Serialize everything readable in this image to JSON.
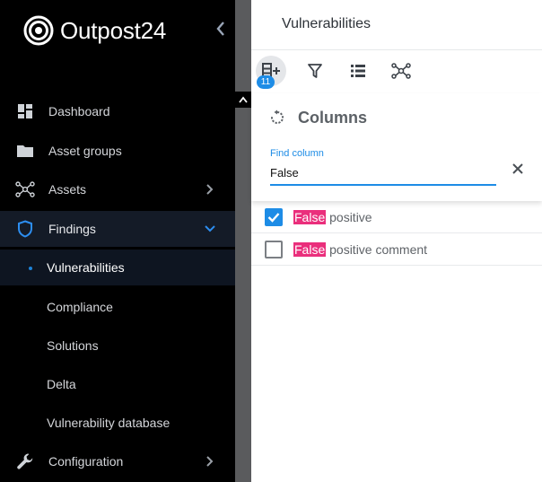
{
  "app": {
    "brand_main": "Outpost",
    "brand_num": "24"
  },
  "sidebar": {
    "items": [
      {
        "label": "Dashboard",
        "icon": "dashboard-icon"
      },
      {
        "label": "Asset groups",
        "icon": "folder-icon"
      },
      {
        "label": "Assets",
        "icon": "network-icon"
      },
      {
        "label": "Findings",
        "icon": "shield-icon",
        "expanded": true
      },
      {
        "label": "Configuration",
        "icon": "wrench-icon"
      }
    ],
    "findings_children": [
      {
        "label": "Vulnerabilities",
        "active": true
      },
      {
        "label": "Compliance"
      },
      {
        "label": "Solutions"
      },
      {
        "label": "Delta"
      },
      {
        "label": "Vulnerability database"
      }
    ]
  },
  "panel": {
    "title": "Vulnerabilities",
    "toolbar": {
      "columns_badge": "11",
      "buttons": [
        "columns-icon",
        "filter-icon",
        "list-icon",
        "graph-icon"
      ]
    },
    "columns": {
      "title": "Columns",
      "search_label": "Find column",
      "search_value": "False",
      "results": [
        {
          "match": "False",
          "rest": " positive",
          "checked": true
        },
        {
          "match": "False",
          "rest": " positive comment",
          "checked": false
        }
      ]
    }
  },
  "colors": {
    "accent": "#1d8ce6",
    "highlight": "#ea2f7c",
    "sidebar_bg": "#000000",
    "active_bg": "#141b27"
  }
}
